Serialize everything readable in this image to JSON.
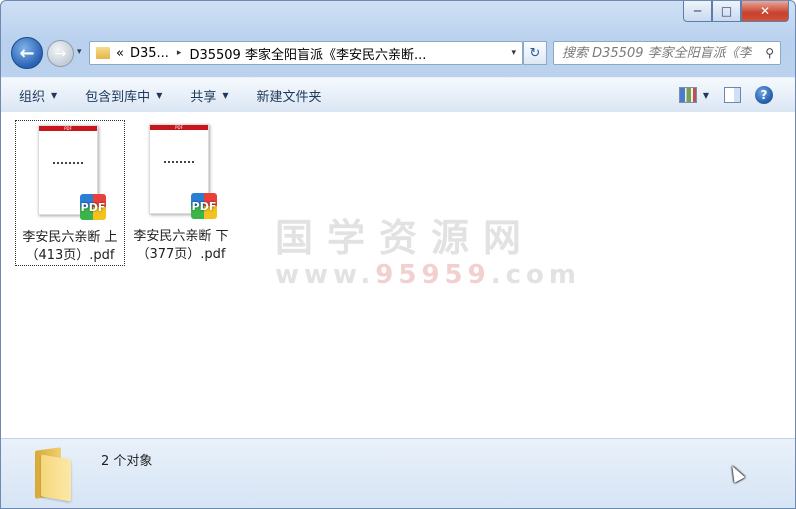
{
  "window": {
    "caption": {
      "minimize": "─",
      "maximize": "□",
      "close": "✕"
    }
  },
  "nav": {
    "back": "←",
    "forward": "→",
    "history": "▾",
    "breadcrumb_overflow": "«",
    "breadcrumb": [
      "D35...",
      "D35509 李家全阳盲派《李安民六亲断..."
    ],
    "breadcrumb_sep": "▸",
    "address_dropdown": "▾",
    "refresh": "↻",
    "search_placeholder": "搜索 D35509 李家全阳盲派《李...",
    "search_icon": "⚲"
  },
  "toolbar": {
    "organize": "组织",
    "include_library": "包含到库中",
    "share": "共享",
    "new_folder": "新建文件夹",
    "dropdown_arrow": "▼",
    "help": "?"
  },
  "files": [
    {
      "name_line1": "李安民六亲断 上",
      "name_line2": "（413页）.pdf",
      "thumb_header": "PDF",
      "badge": "PDF",
      "selected": true
    },
    {
      "name_line1": "李安民六亲断 下",
      "name_line2": "（377页）.pdf",
      "thumb_header": "PDF",
      "badge": "PDF",
      "selected": false
    }
  ],
  "watermark": {
    "line1": "国学资源网",
    "prefix": "www.",
    "number": "95959",
    "suffix": ".com"
  },
  "status": {
    "count": "2 个对象"
  },
  "colors": {
    "accent": "#1e395b",
    "close_button": "#c7412c",
    "pdf_header": "#c8161d"
  }
}
